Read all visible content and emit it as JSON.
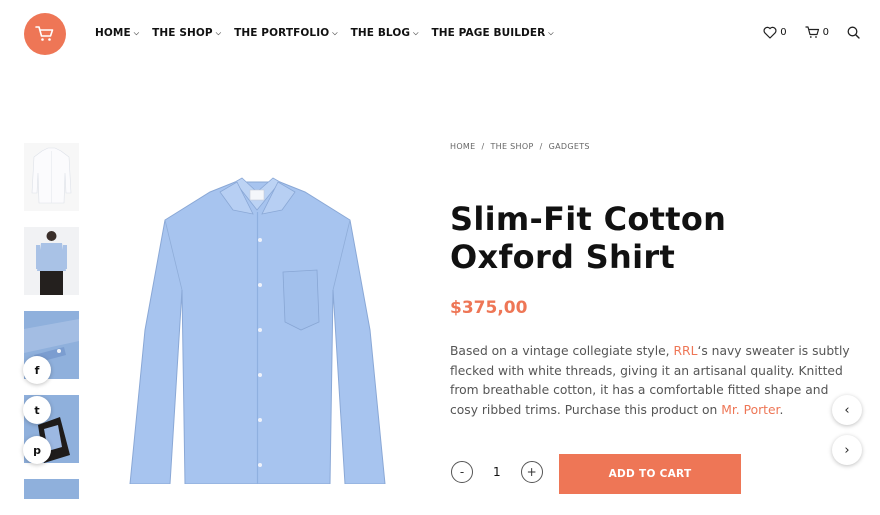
{
  "brand": {
    "accent": "#ee7656",
    "logo_icon": "cart-icon"
  },
  "nav": {
    "items": [
      "HOME",
      "THE SHOP",
      "THE PORTFOLIO",
      "THE BLOG",
      "THE PAGE BUILDER"
    ],
    "chevron_icon": "chevron-down-icon"
  },
  "header": {
    "wishlist_count": "0",
    "cart_count": "0",
    "icons": [
      "heart-icon",
      "cart-icon",
      "search-icon"
    ]
  },
  "breadcrumb": [
    "HOME",
    "THE SHOP",
    "GADGETS"
  ],
  "product": {
    "title": "Slim-Fit Cotton Oxford Shirt",
    "price": "$375,00",
    "desc": {
      "p1": "Based on a vintage collegiate style, ",
      "link1": "RRL",
      "p2": "‘s navy sweater is subtly flecked with white threads, giving it an artisanal quality. Knitted from breathable cotton, it has a comfortable fitted shape and cosy ribbed trims. Purchase this product on ",
      "link2": "Mr. Porter",
      "p3": "."
    },
    "quantity": "1",
    "add_to_cart": "ADD TO CART"
  },
  "share": [
    {
      "name": "facebook-icon",
      "glyph": "f"
    },
    {
      "name": "twitter-icon",
      "glyph": "t"
    },
    {
      "name": "pinterest-icon",
      "glyph": "p"
    }
  ],
  "qty_buttons": {
    "minus": "-",
    "plus": "+"
  },
  "arrows": {
    "prev": "‹",
    "next": "›"
  }
}
